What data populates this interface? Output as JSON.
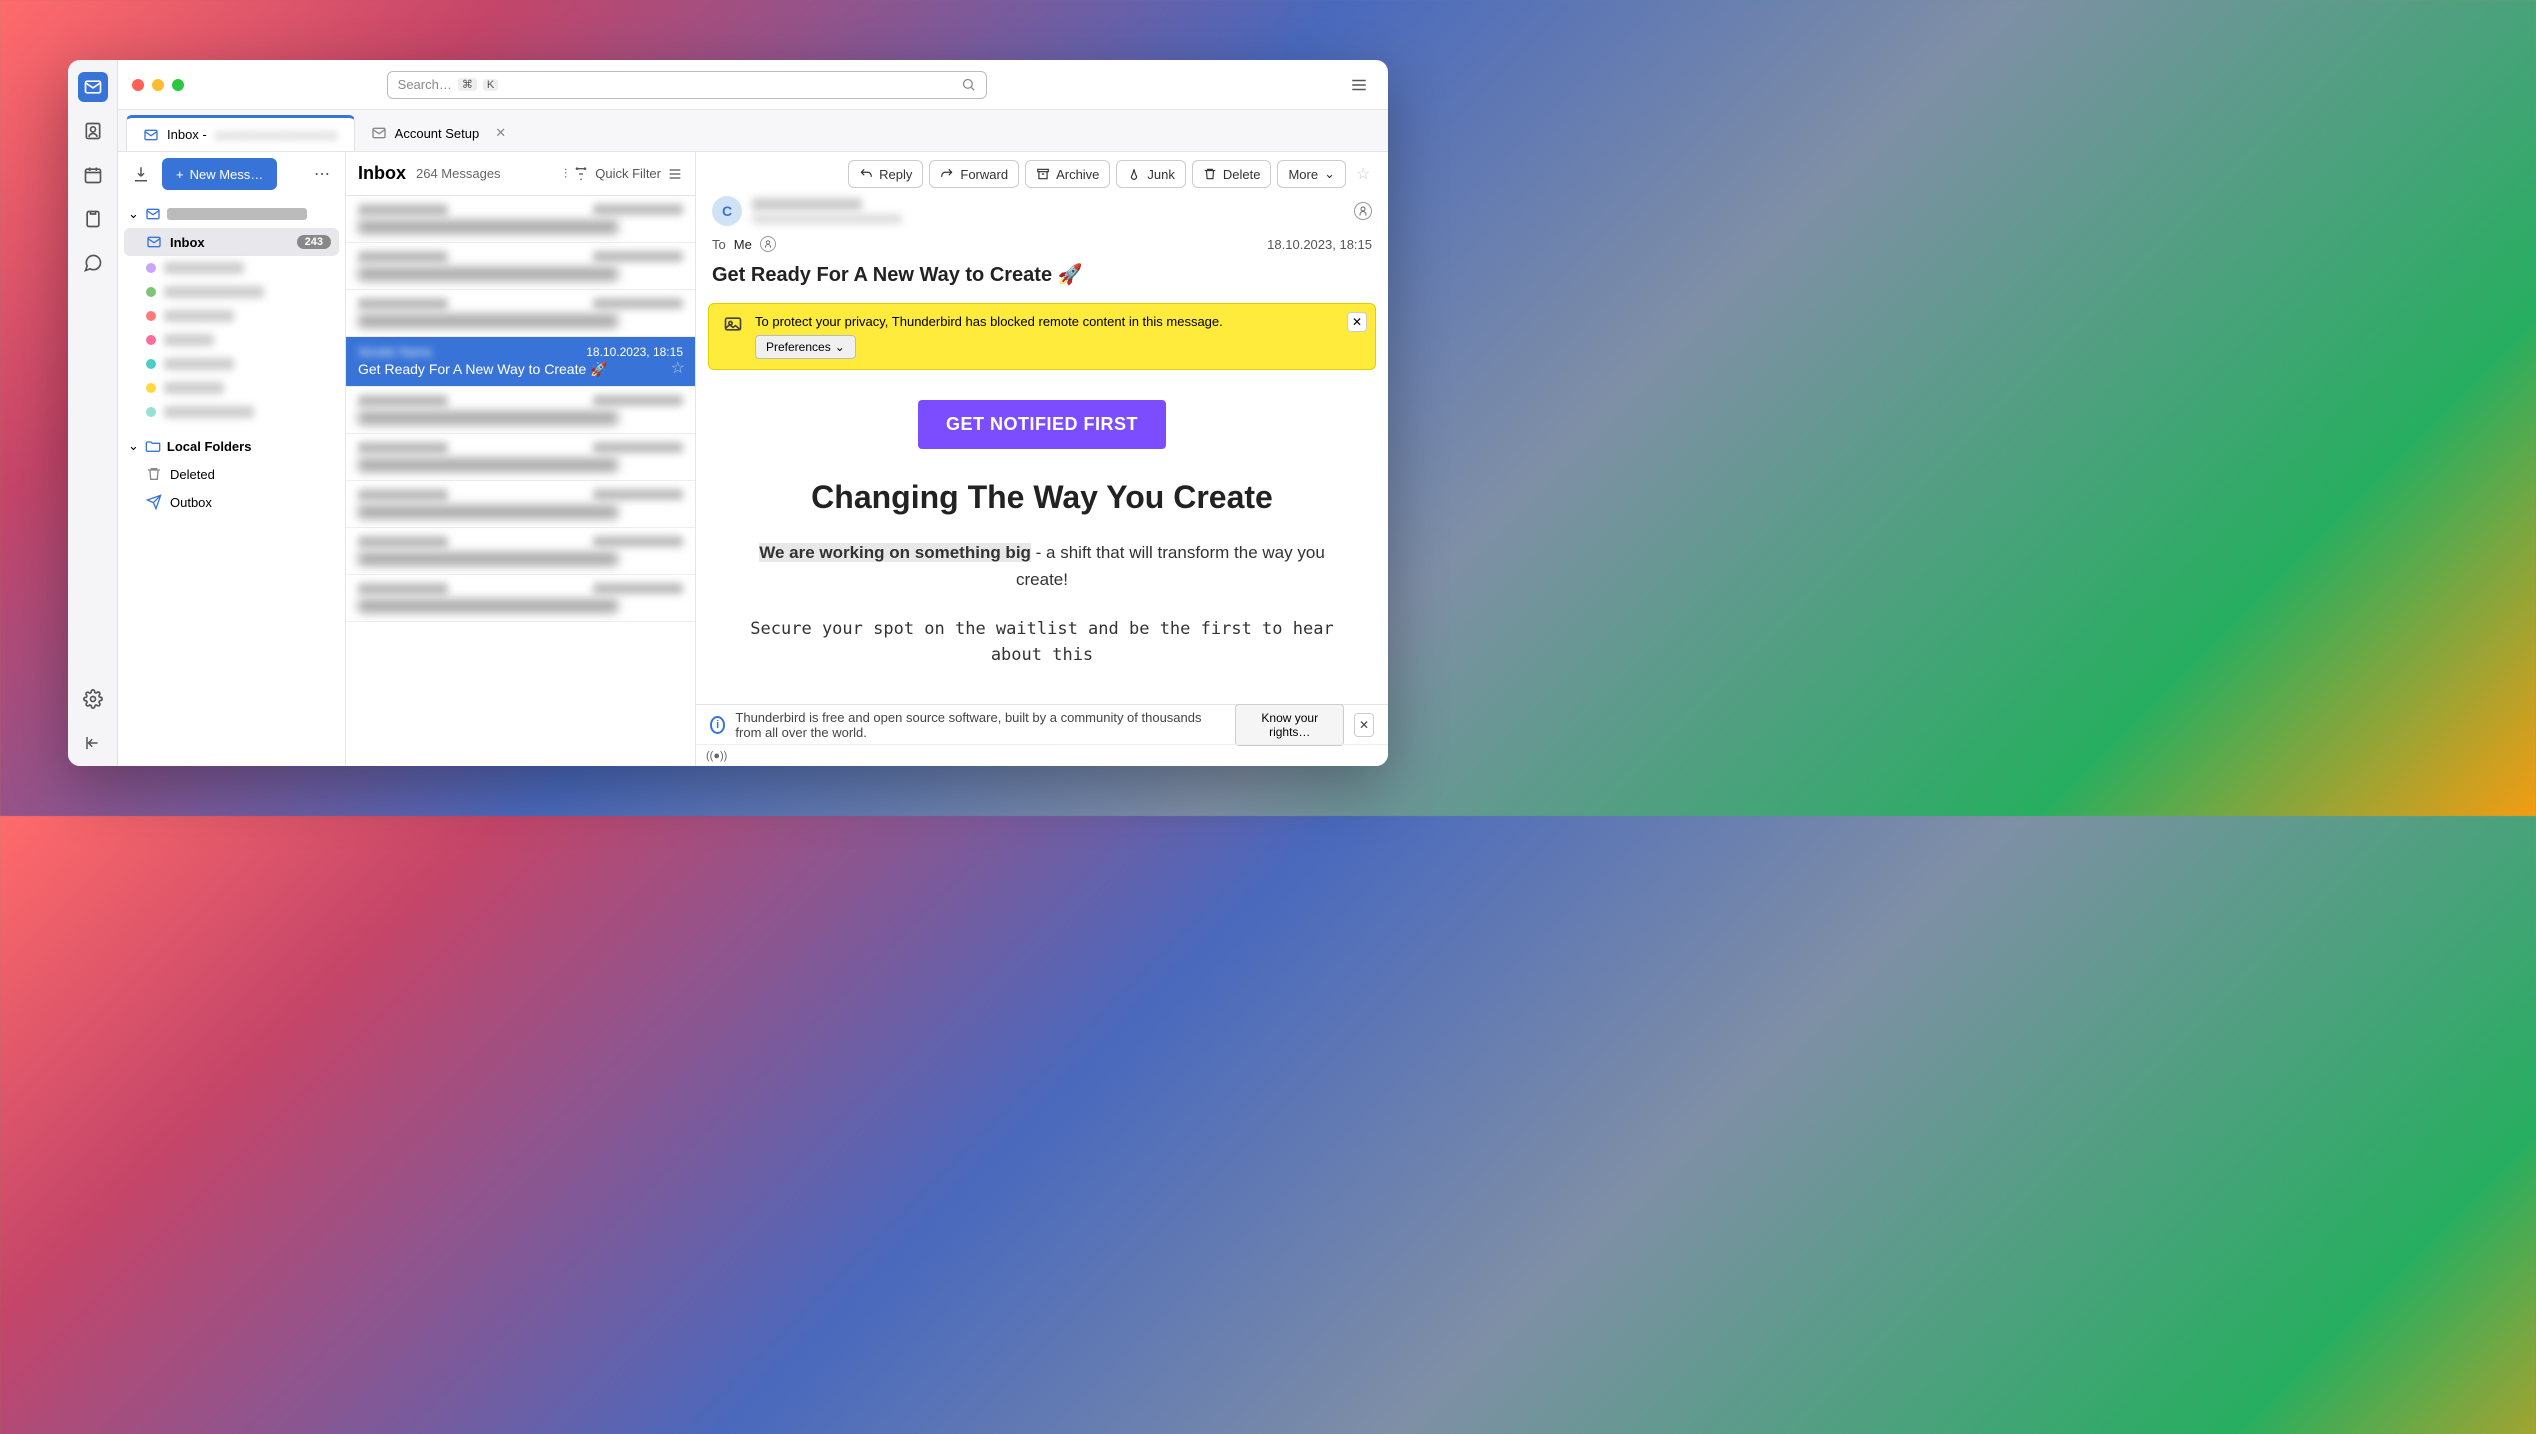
{
  "titlebar": {
    "search_placeholder": "Search…",
    "kbd1": "⌘",
    "kbd2": "K"
  },
  "tabs": [
    {
      "label": "Inbox - ",
      "active": true
    },
    {
      "label": "Account Setup",
      "active": false
    }
  ],
  "folder_pane": {
    "new_message_label": "New Mess…",
    "inbox_label": "Inbox",
    "inbox_badge": "243",
    "local_folders_label": "Local Folders",
    "deleted_label": "Deleted",
    "outbox_label": "Outbox"
  },
  "thread_pane": {
    "title": "Inbox",
    "count": "264 Messages",
    "quick_filter_label": "Quick Filter",
    "selected": {
      "date": "18.10.2023, 18:15",
      "subject": "Get Ready For A New Way to Create 🚀"
    }
  },
  "message_toolbar": {
    "reply": "Reply",
    "forward": "Forward",
    "archive": "Archive",
    "junk": "Junk",
    "delete": "Delete",
    "more": "More"
  },
  "message_header": {
    "avatar_initial": "C",
    "to_label": "To",
    "to_value": "Me",
    "date": "18.10.2023, 18:15",
    "subject": "Get Ready For A New Way to Create 🚀"
  },
  "notice": {
    "text": "To protect your privacy, Thunderbird has blocked remote content in this message.",
    "preferences_label": "Preferences"
  },
  "message_body": {
    "cta": "GET NOTIFIED FIRST",
    "heading": "Changing The Way You Create",
    "p1_bold": "We are working on something big",
    "p1_rest": " - a shift that will transform the way you create!",
    "p2": "Secure your spot on the waitlist and be the first to hear about this"
  },
  "footer": {
    "text": "Thunderbird is free and open source software, built by a community of thousands from all over the world.",
    "rights_label": "Know your rights…"
  },
  "status": {
    "icon": "((●))"
  }
}
